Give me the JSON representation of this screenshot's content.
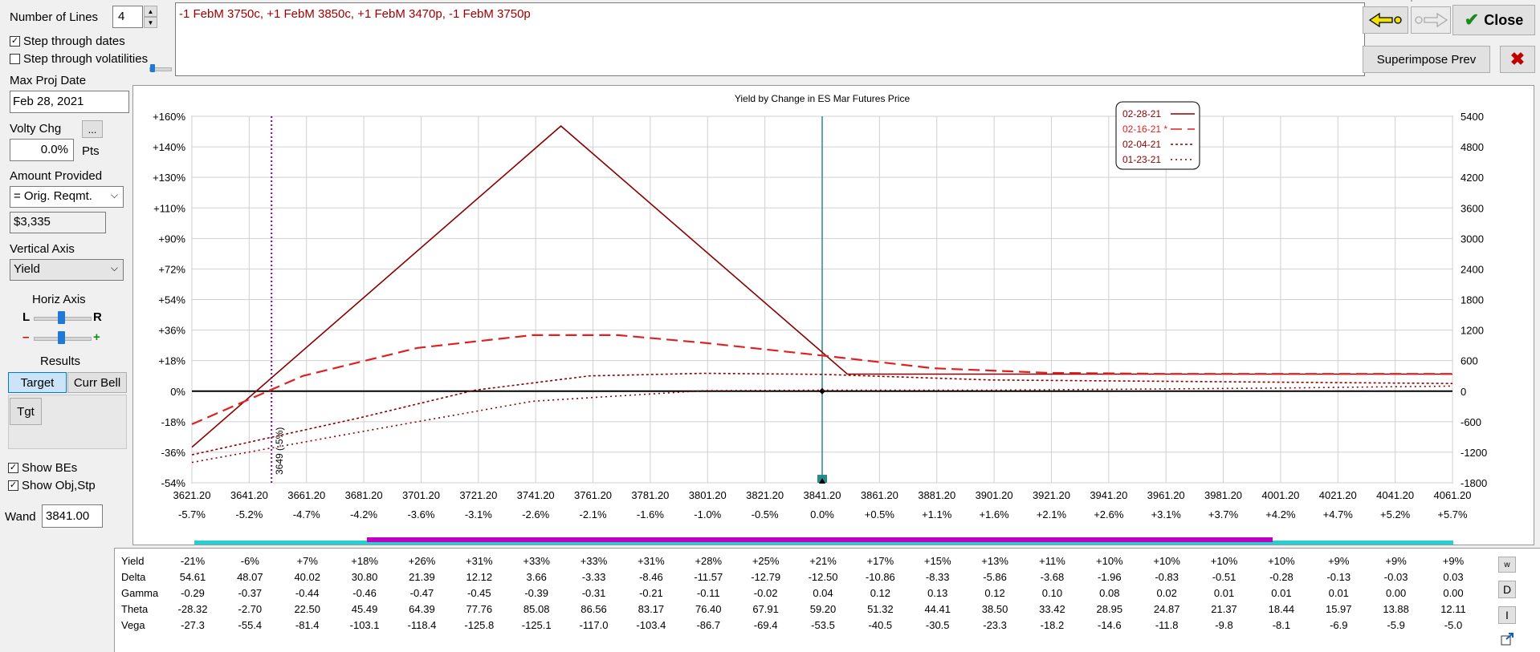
{
  "controls": {
    "num_lines_label": "Number of Lines",
    "num_lines_value": "4",
    "step_dates_label": "Step through dates",
    "step_dates_checked": true,
    "step_vol_label": "Step through volatilities",
    "step_vol_checked": false,
    "max_proj_label": "Max Proj Date",
    "max_proj_value": "Feb 28, 2021",
    "volty_label": "Volty Chg",
    "volty_btn": "...",
    "volty_value": "0.0%",
    "volty_unit": "Pts",
    "amount_label": "Amount Provided",
    "amount_select": "= Orig. Reqmt.",
    "amount_value": "$3,335",
    "vaxis_label": "Vertical Axis",
    "vaxis_select": "Yield",
    "haxis_label": "Horiz Axis",
    "haxis_l": "L",
    "haxis_r": "R",
    "minus": "–",
    "plus": "+",
    "results_label": "Results",
    "target_btn": "Target",
    "currbell_btn": "Curr Bell",
    "tgt_btn": "Tgt",
    "show_bes_label": "Show BEs",
    "show_bes_checked": true,
    "show_obj_label": "Show Obj,Stp",
    "show_obj_checked": true,
    "wand_label": "Wand",
    "wand_value": "3841.00"
  },
  "position_text": "-1 FebM 3750c, +1 FebM 3850c, +1 FebM 3470p, -1 FebM 3750p",
  "buttons": {
    "close": "Close",
    "superimpose": "Superimpose Prev",
    "colors": {
      "accent_green": "#1a8a1a",
      "close_x": "#c00000"
    }
  },
  "chart_data": {
    "type": "line",
    "title": "Yield by Change in ES Mar Futures Price",
    "x_ticks": [
      "3621.20",
      "3641.20",
      "3661.20",
      "3681.20",
      "3701.20",
      "3721.20",
      "3741.20",
      "3761.20",
      "3781.20",
      "3801.20",
      "3821.20",
      "3841.20",
      "3861.20",
      "3881.20",
      "3901.20",
      "3921.20",
      "3941.20",
      "3961.20",
      "3981.20",
      "4001.20",
      "4021.20",
      "4041.20",
      "4061.20"
    ],
    "x_pct_ticks": [
      "-5.7%",
      "-5.2%",
      "-4.7%",
      "-4.2%",
      "-3.6%",
      "-3.1%",
      "-2.6%",
      "-2.1%",
      "-1.6%",
      "-1.0%",
      "-0.5%",
      "0.0%",
      "+0.5%",
      "+1.1%",
      "+1.6%",
      "+2.1%",
      "+2.6%",
      "+3.1%",
      "+3.7%",
      "+4.2%",
      "+4.7%",
      "+5.2%",
      "+5.7%"
    ],
    "xlim": [
      3621.2,
      4061.2
    ],
    "y_left_ticks": [
      "+160%",
      "+140%",
      "+130%",
      "+110%",
      "+90%",
      "+72%",
      "+54%",
      "+36%",
      "+18%",
      "0%",
      "-18%",
      "-36%",
      "-54%"
    ],
    "y_right_ticks": [
      "5400",
      "4800",
      "4200",
      "3600",
      "3000",
      "2400",
      "1800",
      "1200",
      "600",
      "0",
      "-600",
      "-1200",
      "-1800"
    ],
    "ylim_right": [
      -1800,
      5400
    ],
    "legend": [
      "02-28-21",
      "02-16-21 *",
      "02-04-21",
      "01-23-21"
    ],
    "legend_position": "top-right",
    "annotation": "3649 (-5%)",
    "breakeven_x": 3649,
    "wand_x": 3841.2,
    "colors": {
      "line": "#8b0000",
      "dashed": "#e02020",
      "be": "#8000a0",
      "wand": "#2a8a8a"
    },
    "series": [
      {
        "name": "02-28-21",
        "x": [
          3621.2,
          3750,
          3850,
          4061.2
        ],
        "y": [
          -1100,
          5210,
          335,
          335
        ]
      },
      {
        "name": "02-16-21 *",
        "x": [
          3621.2,
          3660,
          3700,
          3740,
          3770,
          3800,
          3841.2,
          3880,
          3920,
          3961.2,
          4061.2
        ],
        "y": [
          -650,
          300,
          850,
          1100,
          1100,
          950,
          700,
          450,
          360,
          340,
          340
        ]
      },
      {
        "name": "02-04-21",
        "x": [
          3621.2,
          3680,
          3720,
          3760,
          3800,
          3841.2,
          3900,
          4061.2
        ],
        "y": [
          -1250,
          -520,
          20,
          300,
          350,
          330,
          220,
          150
        ]
      },
      {
        "name": "01-23-21",
        "x": [
          3621.2,
          3680,
          3740,
          3800,
          3841.2,
          3900,
          4000,
          4061.2
        ],
        "y": [
          -1400,
          -800,
          -200,
          10,
          20,
          20,
          60,
          100
        ]
      }
    ]
  },
  "greeks": {
    "labels": [
      "Yield",
      "Delta",
      "Gamma",
      "Theta",
      "Vega"
    ],
    "rows": [
      [
        "-21%",
        "-6%",
        "+7%",
        "+18%",
        "+26%",
        "+31%",
        "+33%",
        "+33%",
        "+31%",
        "+28%",
        "+25%",
        "+21%",
        "+17%",
        "+15%",
        "+13%",
        "+11%",
        "+10%",
        "+10%",
        "+10%",
        "+10%",
        "+9%",
        "+9%",
        "+9%"
      ],
      [
        "54.61",
        "48.07",
        "40.02",
        "30.80",
        "21.39",
        "12.12",
        "3.66",
        "-3.33",
        "-8.46",
        "-11.57",
        "-12.79",
        "-12.50",
        "-10.86",
        "-8.33",
        "-5.86",
        "-3.68",
        "-1.96",
        "-0.83",
        "-0.51",
        "-0.28",
        "-0.13",
        "-0.03",
        "0.03"
      ],
      [
        "-0.29",
        "-0.37",
        "-0.44",
        "-0.46",
        "-0.47",
        "-0.45",
        "-0.39",
        "-0.31",
        "-0.21",
        "-0.11",
        "-0.02",
        "0.04",
        "0.12",
        "0.13",
        "0.12",
        "0.10",
        "0.08",
        "0.02",
        "0.01",
        "0.01",
        "0.01",
        "0.00",
        "0.00"
      ],
      [
        "-28.32",
        "-2.70",
        "22.50",
        "45.49",
        "64.39",
        "77.76",
        "85.08",
        "86.56",
        "83.17",
        "76.40",
        "67.91",
        "59.20",
        "51.32",
        "44.41",
        "38.50",
        "33.42",
        "28.95",
        "24.87",
        "21.37",
        "18.44",
        "15.97",
        "13.88",
        "12.11"
      ],
      [
        "-27.3",
        "-55.4",
        "-81.4",
        "-103.1",
        "-118.4",
        "-125.8",
        "-125.1",
        "-117.0",
        "-103.4",
        "-86.7",
        "-69.4",
        "-53.5",
        "-40.5",
        "-30.5",
        "-23.3",
        "-18.2",
        "-14.6",
        "-11.8",
        "-9.8",
        "-8.1",
        "-6.9",
        "-5.9",
        "-5.0"
      ]
    ],
    "side_buttons": [
      "w",
      "D",
      "I"
    ]
  }
}
